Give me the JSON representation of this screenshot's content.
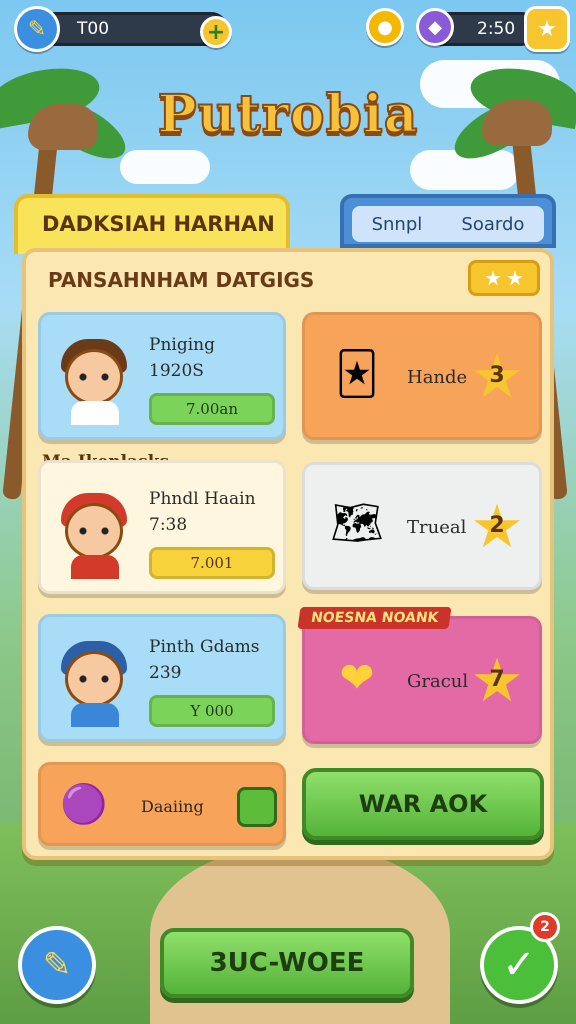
{
  "top_bar": {
    "left_value": "T00",
    "right_value": "2:50",
    "icons": [
      "pencil-icon",
      "plus-icon",
      "coin-icon",
      "gem-icon",
      "star-icon"
    ]
  },
  "title": "Putrobia",
  "tabs": {
    "active": "DADKSIAH HARHAN",
    "right_items": [
      "Snnpl",
      "Soardo"
    ]
  },
  "panel": {
    "subheading": "PANSAHNHAM DATGIGS",
    "section_label": "Ma Ikenlasks",
    "players": [
      {
        "name": "Pniging",
        "time": "1920S",
        "value": "7.00an",
        "pill_color": "green"
      },
      {
        "name": "Phndl Haain",
        "time": "7:38",
        "value": "7.001",
        "pill_color": "yellow"
      },
      {
        "name": "Pinth Gdams",
        "time": "239",
        "value": "Y 000",
        "pill_color": "green"
      }
    ],
    "rewards": [
      {
        "label": "Hande",
        "star_num": "3",
        "icon": "card-icon"
      },
      {
        "label": "Trueal",
        "star_num": "2",
        "icon": "map-icon"
      },
      {
        "label": "Gracul",
        "star_num": "7",
        "icon": "heart-icon",
        "corner_label": "NOESNA NOANK"
      }
    ],
    "bottom_left_label": "Daaiing",
    "bottom_right_button": "WAR AOK"
  },
  "bottom_bar": {
    "main_button": "3UC-WOEE",
    "notification_count": "2"
  },
  "colors": {
    "title": "#f6c23e",
    "panel": "#fbe7b2",
    "green_button": "#55b33a",
    "tab_active": "#f9e35a",
    "tab_right": "#4d8fd6"
  }
}
